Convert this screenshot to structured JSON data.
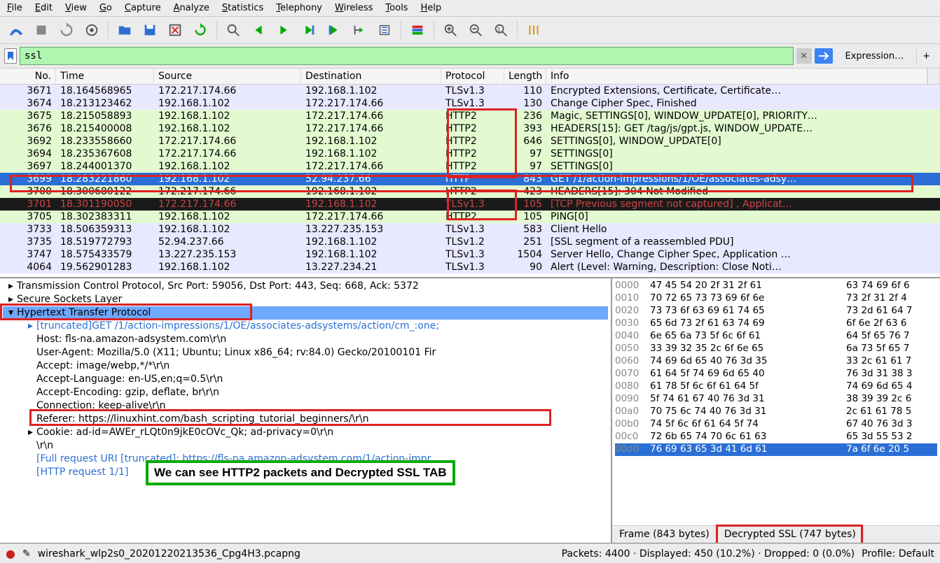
{
  "menu": [
    "File",
    "Edit",
    "View",
    "Go",
    "Capture",
    "Analyze",
    "Statistics",
    "Telephony",
    "Wireless",
    "Tools",
    "Help"
  ],
  "filter": {
    "value": "ssl",
    "expression_label": "Expression…",
    "plus": "+"
  },
  "columns": {
    "no": "No.",
    "time": "Time",
    "source": "Source",
    "destination": "Destination",
    "protocol": "Protocol",
    "length": "Length",
    "info": "Info"
  },
  "packets": [
    {
      "no": "3671",
      "time": "18.164568965",
      "src": "172.217.174.66",
      "dst": "192.168.1.102",
      "proto": "TLSv1.3",
      "len": "110",
      "info": "Encrypted Extensions, Certificate, Certificate…",
      "cls": "bg-lav"
    },
    {
      "no": "3674",
      "time": "18.213123462",
      "src": "192.168.1.102",
      "dst": "172.217.174.66",
      "proto": "TLSv1.3",
      "len": "130",
      "info": "Change Cipher Spec, Finished",
      "cls": "bg-lav"
    },
    {
      "no": "3675",
      "time": "18.215058893",
      "src": "192.168.1.102",
      "dst": "172.217.174.66",
      "proto": "HTTP2",
      "len": "236",
      "info": "Magic, SETTINGS[0], WINDOW_UPDATE[0], PRIORITY…",
      "cls": "bg-grn"
    },
    {
      "no": "3676",
      "time": "18.215400008",
      "src": "192.168.1.102",
      "dst": "172.217.174.66",
      "proto": "HTTP2",
      "len": "393",
      "info": "HEADERS[15]: GET /tag/js/gpt.js, WINDOW_UPDATE…",
      "cls": "bg-grn"
    },
    {
      "no": "3692",
      "time": "18.233558660",
      "src": "172.217.174.66",
      "dst": "192.168.1.102",
      "proto": "HTTP2",
      "len": "646",
      "info": "SETTINGS[0], WINDOW_UPDATE[0]",
      "cls": "bg-grn"
    },
    {
      "no": "3694",
      "time": "18.235367608",
      "src": "172.217.174.66",
      "dst": "192.168.1.102",
      "proto": "HTTP2",
      "len": "97",
      "info": "SETTINGS[0]",
      "cls": "bg-grn"
    },
    {
      "no": "3697",
      "time": "18.244001370",
      "src": "192.168.1.102",
      "dst": "172.217.174.66",
      "proto": "HTTP2",
      "len": "97",
      "info": "SETTINGS[0]",
      "cls": "bg-grn"
    },
    {
      "no": "3699",
      "time": "18.283221860",
      "src": "192.168.1.102",
      "dst": "52.94.237.66",
      "proto": "HTTP",
      "len": "843",
      "info": "GET /1/action-impressions/1/OE/associates-adsy…",
      "cls": "bg-sel"
    },
    {
      "no": "3700",
      "time": "18.300680122",
      "src": "172.217.174.66",
      "dst": "192.168.1.102",
      "proto": "HTTP2",
      "len": "423",
      "info": "HEADERS[15]: 304 Not Modified",
      "cls": "bg-grn"
    },
    {
      "no": "3701",
      "time": "18.301190050",
      "src": "172.217.174.66",
      "dst": "192.168.1.102",
      "proto": "TLSv1.3",
      "len": "105",
      "info": "[TCP Previous segment not captured] , Applicat…",
      "cls": "bg-blk"
    },
    {
      "no": "3705",
      "time": "18.302383311",
      "src": "192.168.1.102",
      "dst": "172.217.174.66",
      "proto": "HTTP2",
      "len": "105",
      "info": "PING[0]",
      "cls": "bg-grn"
    },
    {
      "no": "3733",
      "time": "18.506359313",
      "src": "192.168.1.102",
      "dst": "13.227.235.153",
      "proto": "TLSv1.3",
      "len": "583",
      "info": "Client Hello",
      "cls": "bg-lav"
    },
    {
      "no": "3735",
      "time": "18.519772793",
      "src": "52.94.237.66",
      "dst": "192.168.1.102",
      "proto": "TLSv1.2",
      "len": "251",
      "info": "[SSL segment of a reassembled PDU]",
      "cls": "bg-lav"
    },
    {
      "no": "3747",
      "time": "18.575433579",
      "src": "13.227.235.153",
      "dst": "192.168.1.102",
      "proto": "TLSv1.3",
      "len": "1504",
      "info": "Server Hello, Change Cipher Spec, Application …",
      "cls": "bg-lav"
    },
    {
      "no": "4064",
      "time": "19.562901283",
      "src": "192.168.1.102",
      "dst": "13.227.234.21",
      "proto": "TLSv1.3",
      "len": "90",
      "info": "Alert (Level: Warning, Description: Close Noti…",
      "cls": "bg-lav"
    }
  ],
  "details": [
    {
      "t": "Transmission Control Protocol, Src Port: 59056, Dst Port: 443, Seq: 668, Ack: 5372",
      "exp": "▸",
      "ind": 0
    },
    {
      "t": "Secure Sockets Layer",
      "exp": "▸",
      "ind": 0
    },
    {
      "t": "Hypertext Transfer Protocol",
      "exp": "▾",
      "ind": 0,
      "hl": true
    },
    {
      "t": "[truncated]GET /1/action-impressions/1/OE/associates-adsystems/action/cm_:one;",
      "exp": "▸",
      "ind": 1,
      "blue": true
    },
    {
      "t": "Host: fls-na.amazon-adsystem.com\\r\\n",
      "exp": "",
      "ind": 1
    },
    {
      "t": "User-Agent: Mozilla/5.0 (X11; Ubuntu; Linux x86_64; rv:84.0) Gecko/20100101 Fir",
      "exp": "",
      "ind": 1
    },
    {
      "t": "Accept: image/webp,*/*\\r\\n",
      "exp": "",
      "ind": 1
    },
    {
      "t": "Accept-Language: en-US,en;q=0.5\\r\\n",
      "exp": "",
      "ind": 1
    },
    {
      "t": "Accept-Encoding: gzip, deflate, br\\r\\n",
      "exp": "",
      "ind": 1
    },
    {
      "t": "Connection: keep-alive\\r\\n",
      "exp": "",
      "ind": 1
    },
    {
      "t": "Referer: https://linuxhint.com/bash_scripting_tutorial_beginners/\\r\\n",
      "exp": "",
      "ind": 1
    },
    {
      "t": "Cookie: ad-id=AWEr_rLQt0n9jkE0cOVc_Qk; ad-privacy=0\\r\\n",
      "exp": "▸",
      "ind": 1
    },
    {
      "t": "\\r\\n",
      "exp": "",
      "ind": 1
    },
    {
      "t": "[Full request URI [truncated]: https://fls-na.amazon-adsystem.com/1/action-impr",
      "exp": "",
      "ind": 1,
      "blue": true
    },
    {
      "t": "[HTTP request 1/1]",
      "exp": "",
      "ind": 1,
      "blue": true
    }
  ],
  "hex": [
    {
      "off": "0000",
      "b": "47 45 54 20 2f 31 2f 61",
      "a": "63 74 69 6f 6"
    },
    {
      "off": "0010",
      "b": "70 72 65 73 73 69 6f 6e",
      "a": "73 2f 31 2f 4"
    },
    {
      "off": "0020",
      "b": "73 73 6f 63 69 61 74 65",
      "a": "73 2d 61 64 7"
    },
    {
      "off": "0030",
      "b": "65 6d 73 2f 61 63 74 69",
      "a": "6f 6e 2f 63 6"
    },
    {
      "off": "0040",
      "b": "6e 65 6a 73 5f 6c 6f 61",
      "a": "64 5f 65 76 7"
    },
    {
      "off": "0050",
      "b": "33 39 32 35 2c 6f 6e 65",
      "a": "6a 73 5f 65 7"
    },
    {
      "off": "0060",
      "b": "74 69 6d 65 40 76 3d 35",
      "a": "33 2c 61 61 7"
    },
    {
      "off": "0070",
      "b": "61 64 5f 74 69 6d 65 40",
      "a": "76 3d 31 38 3"
    },
    {
      "off": "0080",
      "b": "61 78 5f 6c 6f 61 64 5f",
      "a": "74 69 6d 65 4"
    },
    {
      "off": "0090",
      "b": "5f 74 61 67 40 76 3d 31",
      "a": "38 39 39 2c 6"
    },
    {
      "off": "00a0",
      "b": "70 75 6c 74 40 76 3d 31",
      "a": "2c 61 61 78 5"
    },
    {
      "off": "00b0",
      "b": "74 5f 6c 6f 61 64 5f 74",
      "a": "67 40 76 3d 3"
    },
    {
      "off": "00c0",
      "b": "72 6b 65 74 70 6c 61 63",
      "a": "65 3d 55 53 2"
    },
    {
      "off": "00d0",
      "b": "76 69 63 65 3d 41 6d 61",
      "a": "7a 6f 6e 20 5",
      "hl": true
    }
  ],
  "hextabs": {
    "frame": "Frame (843 bytes)",
    "ssl": "Decrypted SSL (747 bytes)"
  },
  "status": {
    "file": "wireshark_wlp2s0_20201220213536_Cpg4H3.pcapng",
    "pkts": "Packets: 4400 · Displayed: 450 (10.2%) · Dropped: 0 (0.0%)",
    "profile": "Profile: Default"
  },
  "annotation": "We can see HTTP2 packets and Decrypted SSL TAB"
}
